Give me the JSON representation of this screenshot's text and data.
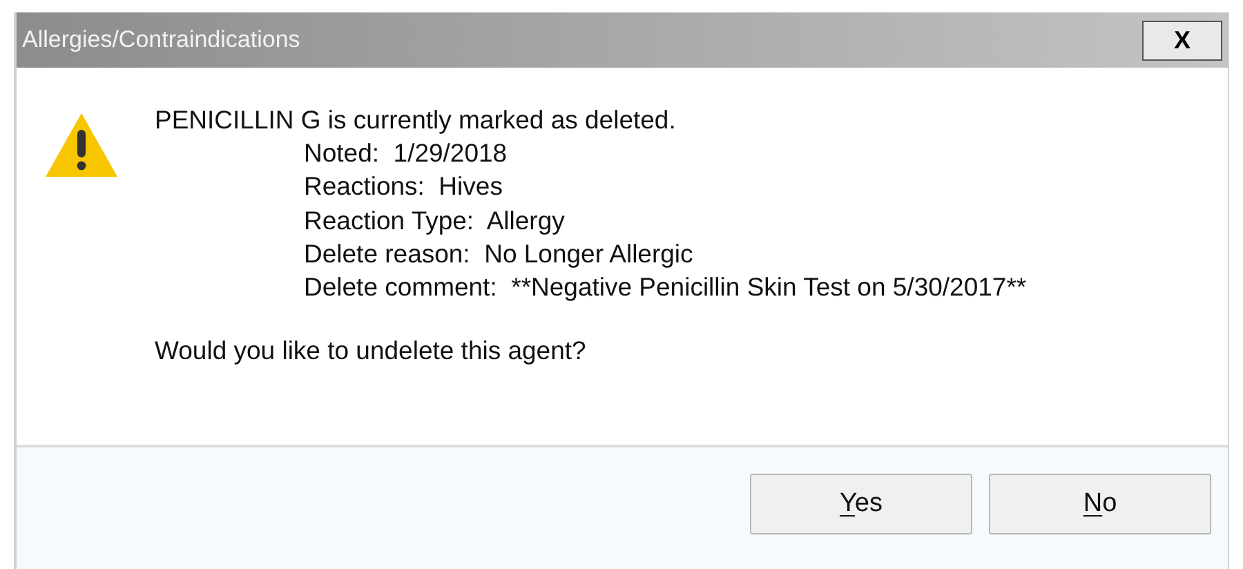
{
  "window": {
    "title": "Allergies/Contraindications",
    "close_label": "X"
  },
  "message": {
    "headline": "PENICILLIN G is currently marked as deleted.",
    "details": [
      {
        "label": "Noted:",
        "value": "1/29/2018"
      },
      {
        "label": "Reactions:",
        "value": "Hives"
      },
      {
        "label": "Reaction Type:",
        "value": "Allergy"
      },
      {
        "label": "Delete reason:",
        "value": "No Longer Allergic"
      },
      {
        "label": "Delete comment:",
        "value": "**Negative Penicillin Skin Test on 5/30/2017**"
      }
    ],
    "question": "Would you like to undelete this agent?"
  },
  "buttons": [
    {
      "access_key": "Y",
      "label_rest": "es"
    },
    {
      "access_key": "N",
      "label_rest": "o"
    }
  ]
}
